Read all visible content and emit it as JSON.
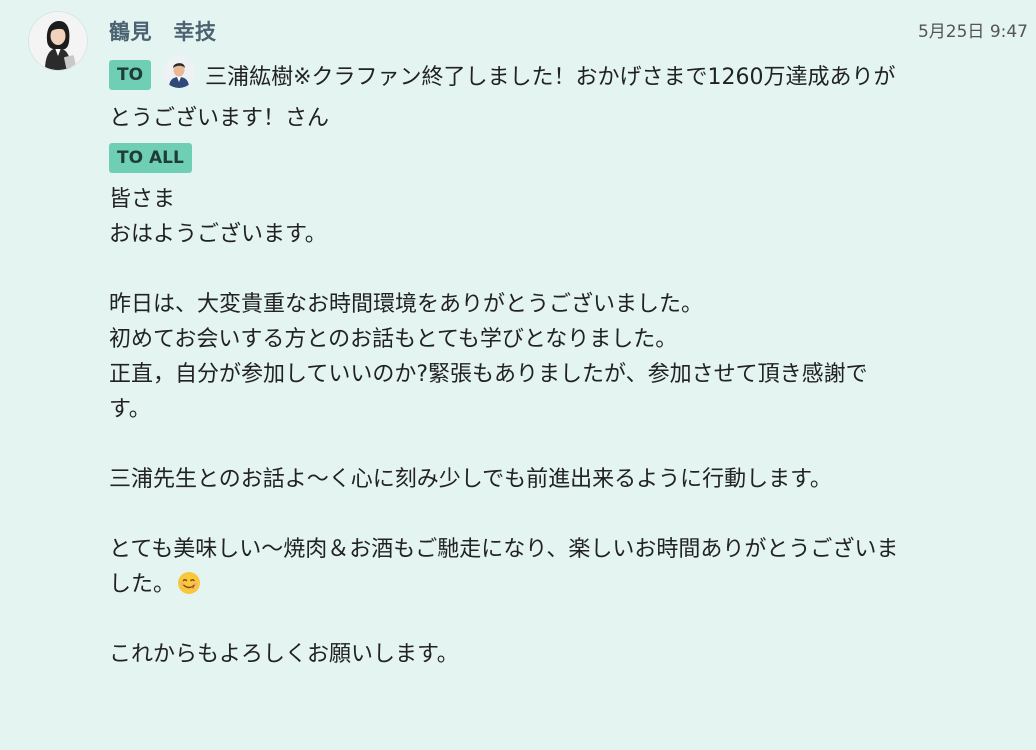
{
  "message": {
    "sender_name": "鶴見　幸技",
    "timestamp": "5月25日 9:47",
    "to_label": "TO",
    "to_text": "三浦紘樹※クラファン終了しました！おかげさまで1260万達成ありがとうございます！さん",
    "to_all_label": "TO ALL",
    "paragraphs": [
      [
        "皆さま",
        "おはようございます。"
      ],
      [
        "昨日は、大変貴重なお時間環境をありがとうございました。",
        "初めてお会いする方とのお話もとても学びとなりました。",
        "正直，自分が参加していいのか?緊張もありましたが、参加させて頂き感謝です。"
      ],
      [
        "三浦先生とのお話よ〜く心に刻み少しでも前進出来るように行動します。"
      ],
      [
        "とても美味しい〜焼肉＆お酒もご馳走になり、楽しいお時間ありがとうございました。"
      ],
      [
        "これからもよろしくお願いします。"
      ]
    ],
    "emoji": "smiling-face-savoring-food"
  },
  "colors": {
    "background": "#e4f4f1",
    "tag_background": "#6fcfb4",
    "sender_name": "#4b6270"
  }
}
